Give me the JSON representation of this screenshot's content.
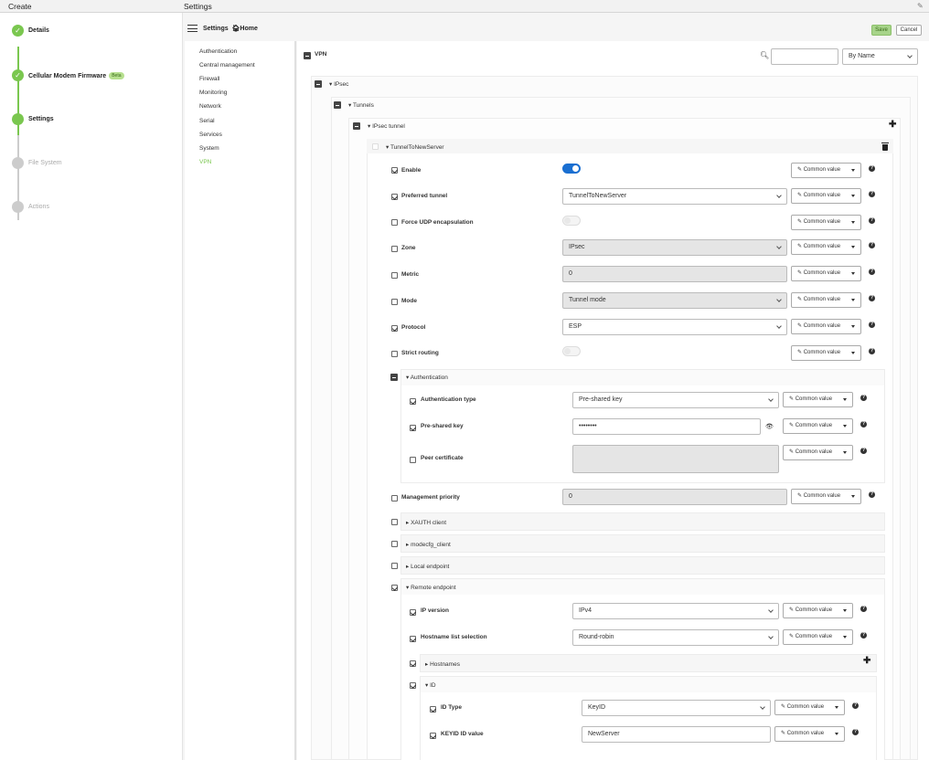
{
  "topbar": {
    "left_title": "Create",
    "right_title": "Settings"
  },
  "wizard": {
    "steps": [
      {
        "label": "Details",
        "state": "done"
      },
      {
        "label": "Cellular Modem Firmware",
        "badge": "Beta",
        "state": "done"
      },
      {
        "label": "Settings",
        "state": "current"
      },
      {
        "label": "File System",
        "state": "pending"
      },
      {
        "label": "Actions",
        "state": "pending"
      }
    ]
  },
  "header": {
    "settings_label": "Settings",
    "home_label": "Home",
    "save_label": "Save",
    "cancel_label": "Cancel"
  },
  "nav": {
    "items": [
      "Authentication",
      "Central management",
      "Firewall",
      "Monitoring",
      "Network",
      "Serial",
      "Services",
      "System",
      "VPN"
    ],
    "active": "VPN"
  },
  "search": {
    "value": "",
    "sort_label": "By Name"
  },
  "tree": {
    "vpn": "VPN",
    "ipsec": "IPsec",
    "tunnels": "Tunnels",
    "ipsec_tunnel": "IPsec tunnel",
    "tunnel_name": "TunnelToNewServer"
  },
  "common_value": "Common value",
  "fields": {
    "enable": {
      "label": "Enable",
      "checked": true,
      "toggle": true
    },
    "preferred_tunnel": {
      "label": "Preferred tunnel",
      "checked": true,
      "value": "TunnelToNewServer"
    },
    "force_udp": {
      "label": "Force UDP encapsulation",
      "checked": false,
      "toggle": false
    },
    "zone": {
      "label": "Zone",
      "checked": false,
      "value": "IPsec"
    },
    "metric": {
      "label": "Metric",
      "checked": false,
      "value": "0"
    },
    "mode": {
      "label": "Mode",
      "checked": false,
      "value": "Tunnel mode"
    },
    "protocol": {
      "label": "Protocol",
      "checked": true,
      "value": "ESP"
    },
    "strict_routing": {
      "label": "Strict routing",
      "checked": false,
      "toggle": false
    },
    "authentication": "Authentication",
    "auth_type": {
      "label": "Authentication type",
      "checked": true,
      "value": "Pre-shared key"
    },
    "psk": {
      "label": "Pre-shared key",
      "checked": true,
      "value": "••••••••"
    },
    "peer_cert": {
      "label": "Peer certificate",
      "checked": false
    },
    "mgmt_priority": {
      "label": "Management priority",
      "checked": false,
      "value": "0"
    },
    "xauth": "XAUTH client",
    "modecfg": "modecfg_client",
    "local_endpoint": "Local endpoint",
    "remote_endpoint": "Remote endpoint",
    "ip_version": {
      "label": "IP version",
      "checked": true,
      "value": "IPv4"
    },
    "hostname_sel": {
      "label": "Hostname list selection",
      "checked": true,
      "value": "Round-robin"
    },
    "hostnames": "Hostnames",
    "id": "ID",
    "id_type": {
      "label": "ID Type",
      "checked": true,
      "value": "KeyID"
    },
    "keyid": {
      "label": "KEYID ID value",
      "checked": true,
      "value": "NewServer"
    }
  }
}
